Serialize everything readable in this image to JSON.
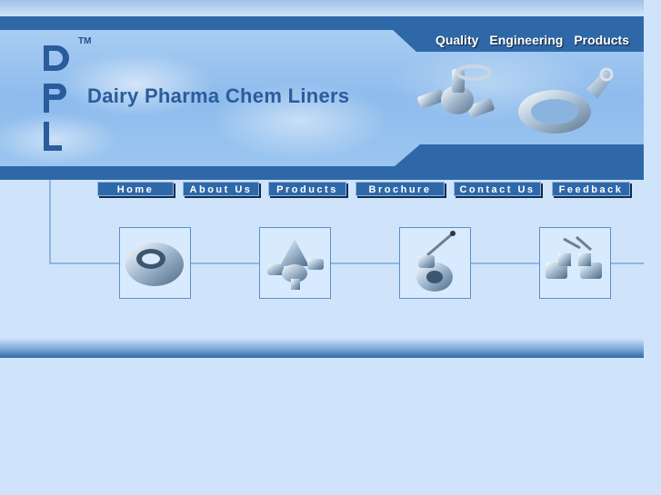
{
  "header": {
    "tm": "TM",
    "company_name": "Dairy Pharma Chem Liners",
    "tagline": [
      "Quality",
      "Engineering",
      "Products"
    ]
  },
  "nav": {
    "items": [
      {
        "label": "Home"
      },
      {
        "label": "About Us"
      },
      {
        "label": "Products"
      },
      {
        "label": "Brochure"
      },
      {
        "label": "Contact Us"
      },
      {
        "label": "Feedback"
      }
    ]
  },
  "thumbnails": [
    {
      "icon": "ring-fitting-icon"
    },
    {
      "icon": "valve-body-icon"
    },
    {
      "icon": "butterfly-valve-icon"
    },
    {
      "icon": "sample-valve-icon"
    }
  ],
  "colors": {
    "primary": "#2f68a8",
    "background": "#cfe4fb",
    "text": "#2a5c9c"
  }
}
